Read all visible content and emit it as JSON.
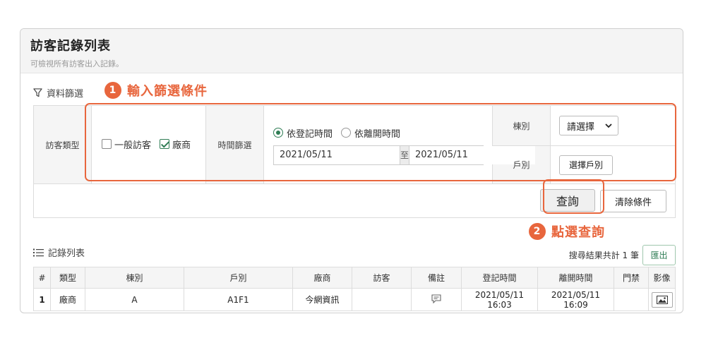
{
  "header": {
    "title": "訪客記錄列表",
    "subtitle": "可檢視所有訪客出入記錄。"
  },
  "filter": {
    "section_label": "資料篩選",
    "visitor_type_label": "訪客類型",
    "visitor_types": [
      {
        "label": "一般訪客",
        "checked": false
      },
      {
        "label": "廠商",
        "checked": true
      }
    ],
    "time_filter_label": "時間篩選",
    "time_options": [
      {
        "label": "依登記時間",
        "selected": true
      },
      {
        "label": "依離開時間",
        "selected": false
      }
    ],
    "date_from": "2021/05/11",
    "date_separator": "至",
    "date_to": "2021/05/11",
    "building_label": "棟別",
    "building_select": "請選擇",
    "unit_label": "戶別",
    "unit_button": "選擇戶別",
    "search_button": "查詢",
    "clear_button": "清除條件"
  },
  "callouts": {
    "step1_number": "1",
    "step1_text": "輸入篩選條件",
    "step2_number": "2",
    "step2_text": "點選查詢"
  },
  "records": {
    "section_label": "記錄列表",
    "result_count": "搜尋結果共計 1 筆",
    "export_button": "匯出",
    "columns": [
      "#",
      "類型",
      "棟別",
      "戶別",
      "廠商",
      "訪客",
      "備註",
      "登記時間",
      "離開時間",
      "門禁",
      "影像"
    ],
    "rows": [
      {
        "no": "1",
        "type": "廠商",
        "building": "A",
        "unit": "A1F1",
        "vendor": "今網資訊",
        "visitor": "",
        "register_time": "2021/05/11 16:03",
        "leave_time": "2021/05/11 16:09",
        "access": ""
      }
    ]
  },
  "colors": {
    "accent_orange": "#e8663d",
    "accent_green": "#2f7d55"
  }
}
